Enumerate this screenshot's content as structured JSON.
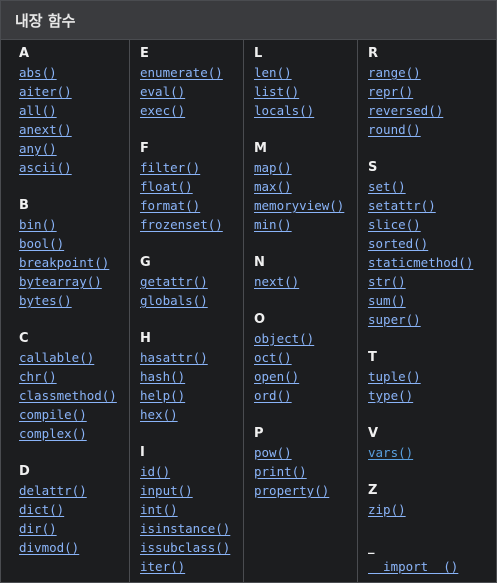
{
  "title": "내장 함수",
  "columns": [
    [
      {
        "letter": "A",
        "items": [
          "abs()",
          "aiter()",
          "all()",
          "anext()",
          "any()",
          "ascii()"
        ]
      },
      {
        "letter": "B",
        "items": [
          "bin()",
          "bool()",
          "breakpoint()",
          "bytearray()",
          "bytes()"
        ]
      },
      {
        "letter": "C",
        "items": [
          "callable()",
          "chr()",
          "classmethod()",
          "compile()",
          "complex()"
        ]
      },
      {
        "letter": "D",
        "items": [
          "delattr()",
          "dict()",
          "dir()",
          "divmod()"
        ]
      }
    ],
    [
      {
        "letter": "E",
        "items": [
          "enumerate()",
          "eval()",
          "exec()"
        ]
      },
      {
        "letter": "F",
        "items": [
          "filter()",
          "float()",
          "format()",
          "frozenset()"
        ]
      },
      {
        "letter": "G",
        "items": [
          "getattr()",
          "globals()"
        ]
      },
      {
        "letter": "H",
        "items": [
          "hasattr()",
          "hash()",
          "help()",
          "hex()"
        ]
      },
      {
        "letter": "I",
        "items": [
          "id()",
          "input()",
          "int()",
          "isinstance()",
          "issubclass()",
          "iter()"
        ]
      }
    ],
    [
      {
        "letter": "L",
        "items": [
          "len()",
          "list()",
          "locals()"
        ]
      },
      {
        "letter": "M",
        "items": [
          "map()",
          "max()",
          "memoryview()",
          "min()"
        ]
      },
      {
        "letter": "N",
        "items": [
          "next()"
        ]
      },
      {
        "letter": "O",
        "items": [
          "object()",
          "oct()",
          "open()",
          "ord()"
        ]
      },
      {
        "letter": "P",
        "items": [
          "pow()",
          "print()",
          "property()"
        ]
      }
    ],
    [
      {
        "letter": "R",
        "items": [
          "range()",
          "repr()",
          "reversed()",
          "round()"
        ]
      },
      {
        "letter": "S",
        "items": [
          "set()",
          "setattr()",
          "slice()",
          "sorted()",
          "staticmethod()",
          "str()",
          "sum()",
          "super()"
        ]
      },
      {
        "letter": "T",
        "items": [
          "tuple()",
          "type()"
        ]
      },
      {
        "letter": "V",
        "items": [
          "vars()"
        ]
      },
      {
        "letter": "Z",
        "items": [
          "zip()"
        ]
      },
      {
        "letter": "_",
        "items": [
          "__import__()"
        ]
      }
    ]
  ],
  "visited": [
    "vars()"
  ],
  "colors": {
    "link": "#8ab4f8",
    "link_visited": "#5aa0e0",
    "header_bg": "#3a3b3e",
    "panel_bg": "#1c1d1f",
    "border": "#4a4c50"
  }
}
